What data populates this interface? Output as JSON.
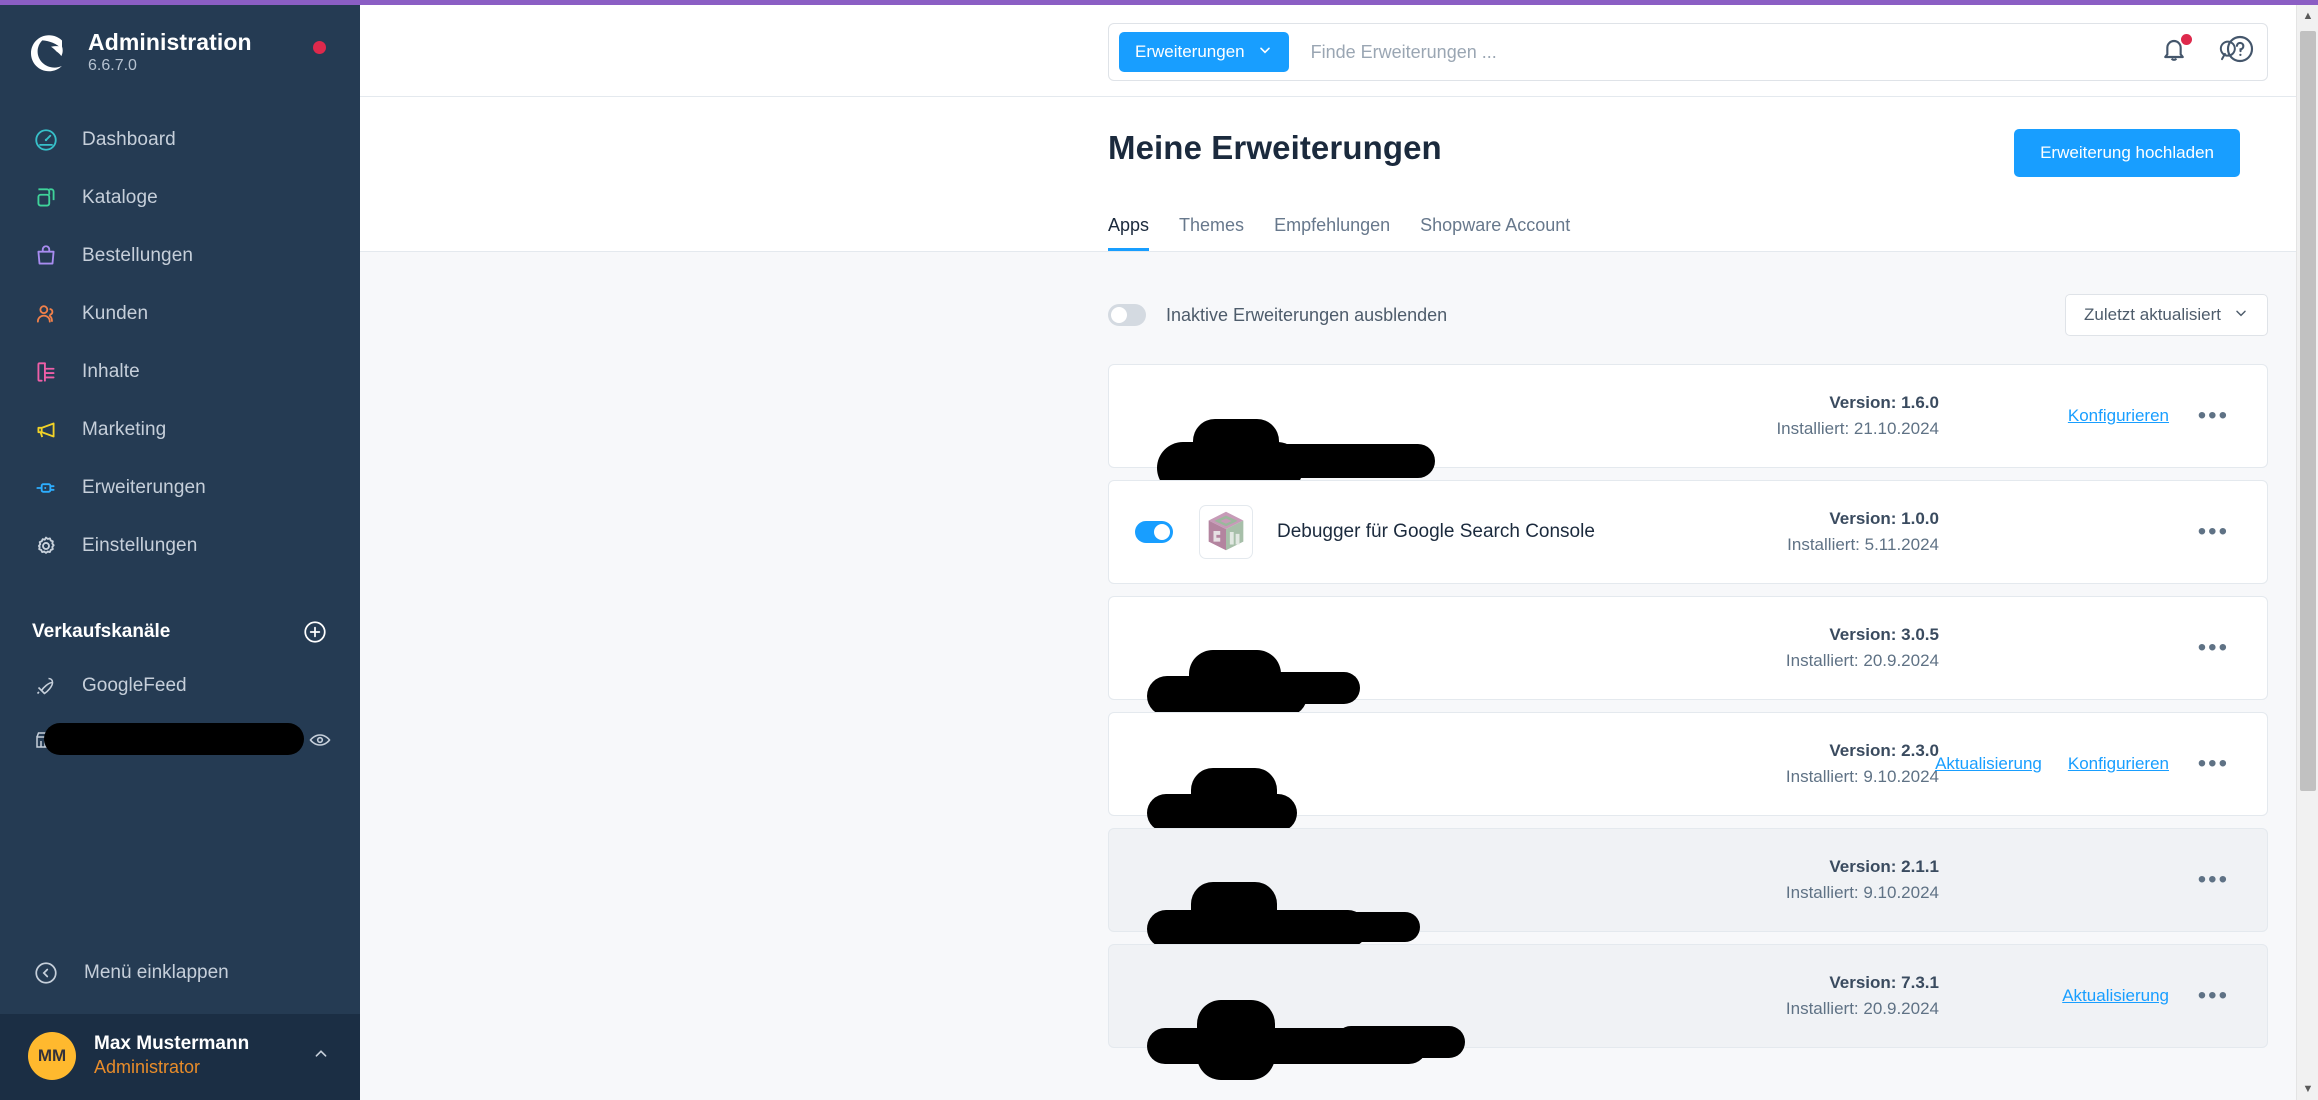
{
  "brand": {
    "title": "Administration",
    "version": "6.6.7.0",
    "logo_icon": "shopware-logo-icon",
    "status_dot_color": "#de294c"
  },
  "sidebar": {
    "items": [
      {
        "label": "Dashboard",
        "icon": "gauge-icon",
        "color": "#37c0c9"
      },
      {
        "label": "Kataloge",
        "icon": "layers-icon",
        "color": "#3fd39a"
      },
      {
        "label": "Bestellungen",
        "icon": "bag-icon",
        "color": "#a88cf0"
      },
      {
        "label": "Kunden",
        "icon": "users-icon",
        "color": "#f0804a"
      },
      {
        "label": "Inhalte",
        "icon": "content-icon",
        "color": "#ef5fa8"
      },
      {
        "label": "Marketing",
        "icon": "megaphone-icon",
        "color": "#f2d227"
      },
      {
        "label": "Erweiterungen",
        "icon": "plug-icon",
        "color": "#2daeff"
      },
      {
        "label": "Einstellungen",
        "icon": "gear-icon",
        "color": "#c9d2dc"
      }
    ],
    "sales_channels": {
      "title": "Verkaufskanäle",
      "add_icon": "plus-circle-icon",
      "items": [
        {
          "label": "GoogleFeed",
          "icon": "rocket-icon",
          "redacted": false,
          "eye": false
        },
        {
          "label": "",
          "icon": "storefront-icon",
          "redacted": true,
          "eye": true
        }
      ]
    },
    "collapse": {
      "label": "Menü einklappen",
      "icon": "chevron-left-circle-icon"
    },
    "user": {
      "initials": "MM",
      "name": "Max Mustermann",
      "role": "Administrator",
      "caret_icon": "chevron-up-icon",
      "avatar_color": "#ffb92e"
    }
  },
  "topbar": {
    "scope_label": "Erweiterungen",
    "scope_caret_icon": "chevron-down-icon",
    "search_placeholder": "Finde Erweiterungen ...",
    "search_value": "",
    "search_icon": "search-icon",
    "notifications_icon": "bell-icon",
    "help_icon": "question-circle-icon",
    "has_notification": true
  },
  "page": {
    "title": "Meine Erweiterungen",
    "upload_button": "Erweiterung hochladen",
    "tabs": [
      {
        "label": "Apps",
        "active": true
      },
      {
        "label": "Themes",
        "active": false
      },
      {
        "label": "Empfehlungen",
        "active": false
      },
      {
        "label": "Shopware Account",
        "active": false
      }
    ],
    "filter": {
      "toggle_label": "Inaktive Erweiterungen ausblenden",
      "toggle_on": false,
      "sort_label": "Zuletzt aktualisiert",
      "sort_caret_icon": "chevron-down-icon"
    },
    "labels": {
      "version_prefix": "Version:",
      "installed_prefix": "Installiert:",
      "configure": "Konfigurieren",
      "update": "Aktualisierung",
      "menu_icon": "ellipsis-icon"
    },
    "extensions": [
      {
        "name": "",
        "redacted": true,
        "inactive": false,
        "toggle_on": false,
        "toggle_hidden": true,
        "version": "Version: 1.6.0",
        "installed": "Installiert: 21.10.2024",
        "links": [
          "Konfigurieren"
        ],
        "blob": "wide-1"
      },
      {
        "name": "Debugger für Google Search Console",
        "redacted": false,
        "inactive": false,
        "toggle_on": true,
        "toggle_hidden": false,
        "version": "Version: 1.0.0",
        "installed": "Installiert: 5.11.2024",
        "links": [],
        "icon": "cube-plugin-icon"
      },
      {
        "name": "",
        "redacted": true,
        "inactive": false,
        "toggle_on": true,
        "toggle_hidden": true,
        "version": "Version: 3.0.5",
        "installed": "Installiert: 20.9.2024",
        "links": [],
        "blob": "wide-2"
      },
      {
        "name": "",
        "redacted": true,
        "inactive": false,
        "toggle_on": false,
        "toggle_hidden": true,
        "version": "Version: 2.3.0",
        "installed": "Installiert: 9.10.2024",
        "links": [
          "Aktualisierung",
          "Konfigurieren"
        ],
        "blob": "wide-3"
      },
      {
        "name": "",
        "redacted": true,
        "inactive": true,
        "toggle_on": false,
        "toggle_hidden": true,
        "version": "Version: 2.1.1",
        "installed": "Installiert: 9.10.2024",
        "links": [],
        "blob": "wide-4"
      },
      {
        "name": "",
        "redacted": true,
        "inactive": true,
        "toggle_on": false,
        "toggle_hidden": true,
        "version": "Version: 7.3.1",
        "installed": "Installiert: 20.9.2024",
        "links": [
          "Aktualisierung"
        ],
        "blob": "wide-5"
      }
    ]
  },
  "scrollbar": {
    "up_arrow": "▲",
    "down_arrow": "▼"
  }
}
